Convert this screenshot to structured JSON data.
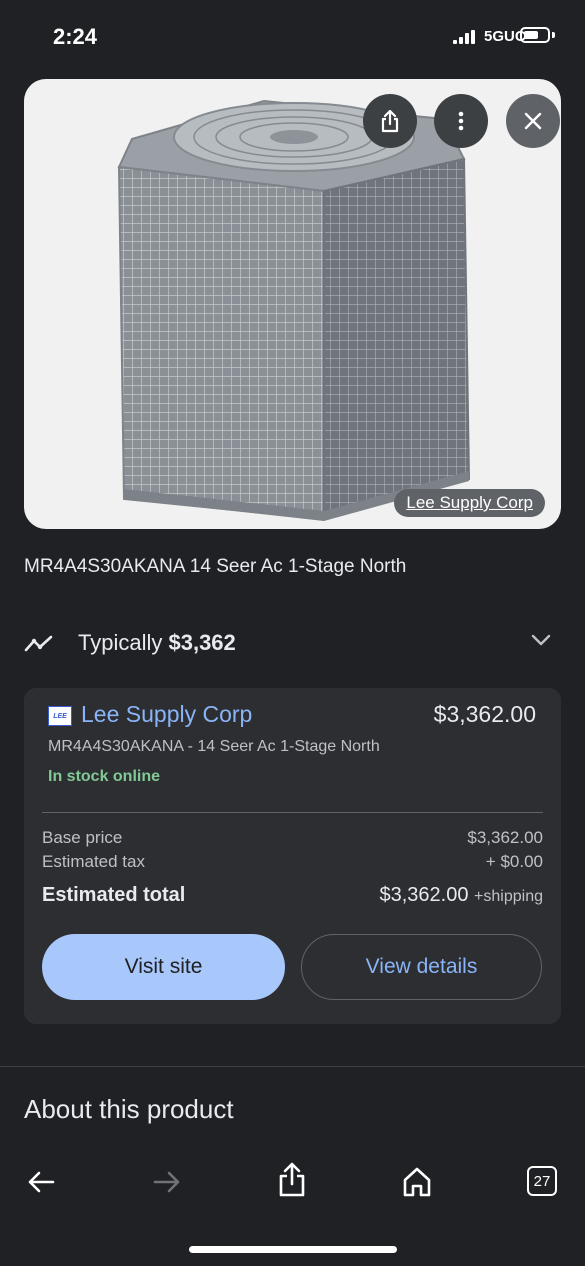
{
  "status_bar": {
    "time": "2:24",
    "network": "5GUC"
  },
  "image": {
    "source": "Lee Supply Corp",
    "alt": "air-conditioner-condenser"
  },
  "product": {
    "title": "MR4A4S30AKANA 14 Seer Ac 1-Stage North"
  },
  "typical": {
    "label": "Typically",
    "price": "$3,362"
  },
  "offer": {
    "logo_text": "LEE",
    "merchant": "Lee Supply Corp",
    "price": "$3,362.00",
    "subtitle": "MR4A4S30AKANA - 14 Seer Ac 1-Stage North",
    "stock": "In stock online",
    "base_price_label": "Base price",
    "base_price": "$3,362.00",
    "tax_label": "Estimated tax",
    "tax": "+ $0.00",
    "total_label": "Estimated total",
    "total": "$3,362.00",
    "shipping": "+shipping",
    "visit_label": "Visit site",
    "details_label": "View details"
  },
  "about": {
    "title": "About this product"
  },
  "nav": {
    "tabs_count": "27"
  },
  "colors": {
    "background": "#202124",
    "card": "#2d2e31",
    "link": "#8ab4f8",
    "primary_button": "#a8c7fa",
    "stock": "#81c995"
  }
}
